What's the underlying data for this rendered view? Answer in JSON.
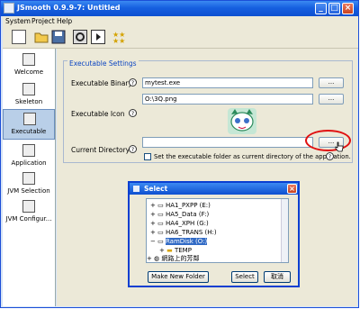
{
  "window": {
    "title": "JSmooth 0.9.9-7: Untitled",
    "controls": {
      "minimize": "_",
      "maximize": "□",
      "close": "×"
    }
  },
  "menu": [
    "System",
    "Project",
    "Help"
  ],
  "toolbar": [
    "new-icon",
    "open-icon",
    "save-icon",
    "settings-icon",
    "run-icon",
    "stars-icon"
  ],
  "sidebar": [
    {
      "label": "Welcome",
      "icon": "welcome-icon"
    },
    {
      "label": "Skeleton",
      "icon": "skeleton-icon"
    },
    {
      "label": "Executable",
      "icon": "executable-icon",
      "selected": true
    },
    {
      "label": "Application",
      "icon": "application-icon"
    },
    {
      "label": "JVM Selection",
      "icon": "jvm-selection-icon"
    },
    {
      "label": "JVM Configur...",
      "icon": "jvm-config-icon"
    }
  ],
  "executable_settings": {
    "group_title": "Executable Settings",
    "binary_label": "Executable Binary",
    "binary_value": "mytest.exe",
    "icon_path_value": "O:\\3Q.png",
    "icon_label": "Executable Icon",
    "dir_label": "Current Directory",
    "dir_value": "",
    "browse_label": "...",
    "checkbox_label": "Set the executable folder as current directory of the application.",
    "help": "?"
  },
  "dialog": {
    "title": "Select",
    "tree": [
      {
        "label": "HA1_PXPP (E:)",
        "expander": "+"
      },
      {
        "label": "HA5_Data (F:)",
        "expander": "+"
      },
      {
        "label": "HA4_XPH (G:)",
        "expander": "+"
      },
      {
        "label": "HA6_TRANS (H:)",
        "expander": "+"
      },
      {
        "label": "RamDisk (O:)",
        "expander": "−",
        "selected": true
      },
      {
        "label": "TEMP",
        "expander": "+"
      },
      {
        "label": "網路上的芳鄰",
        "expander": "+"
      }
    ],
    "buttons": {
      "new_folder": "Make New Folder",
      "select": "Select",
      "cancel": "取消"
    }
  },
  "colors": {
    "accent": "#0c45c2",
    "title_blue": "#1660e0",
    "highlight": "#e01010"
  }
}
